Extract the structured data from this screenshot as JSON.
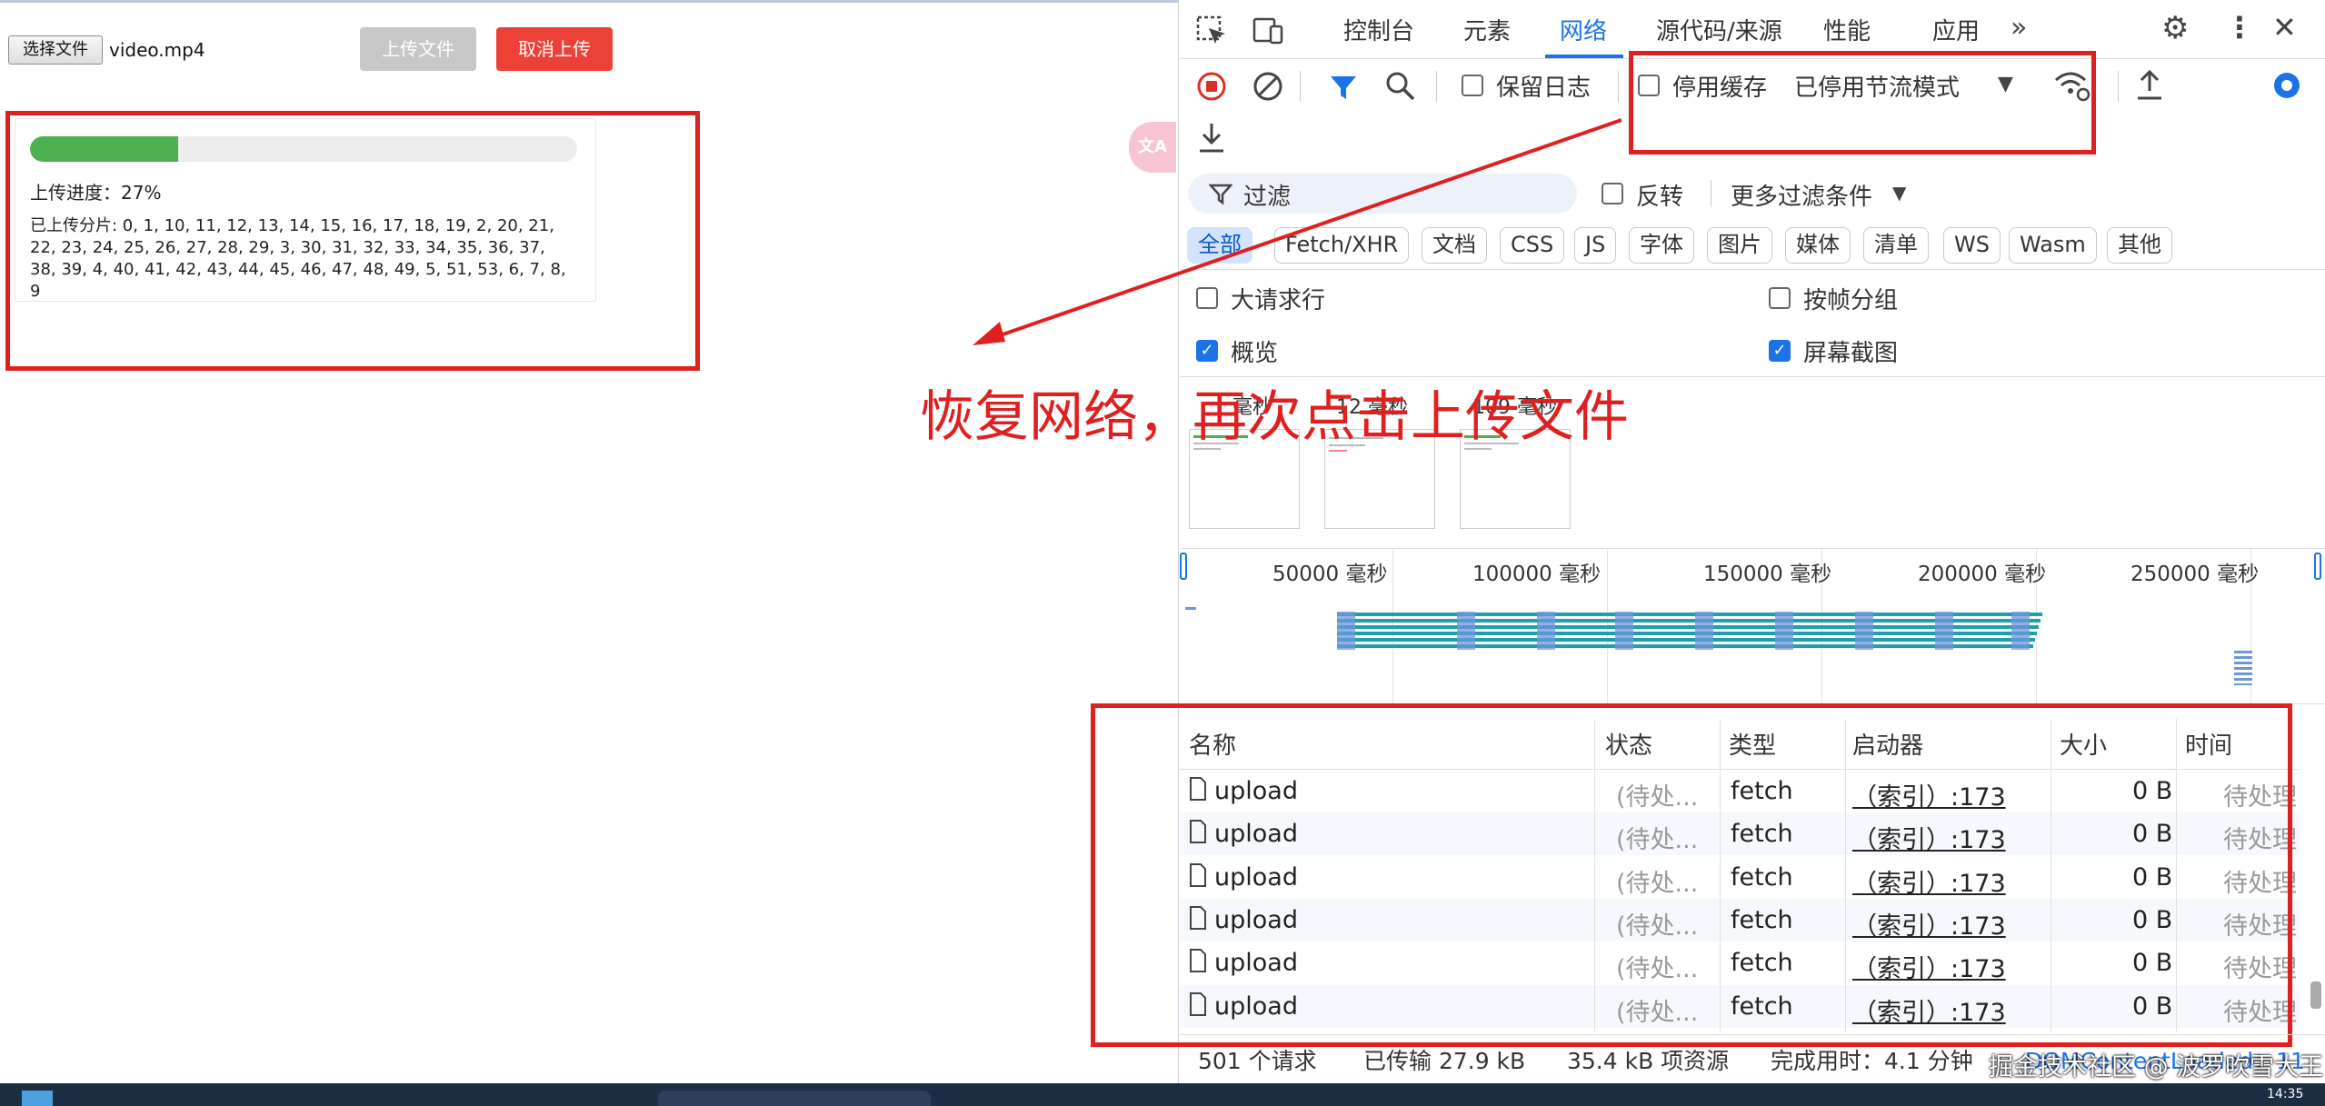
{
  "page": {
    "file_button_label": "选择文件",
    "file_name": "video.mp4",
    "upload_button": "上传文件",
    "cancel_button": "取消上传",
    "progress_percent": 27,
    "progress_text": "上传进度：27%",
    "uploaded_chunks_text": "已上传分片: 0, 1, 10, 11, 12, 13, 14, 15, 16, 17, 18, 19, 2, 20, 21, 22, 23, 24, 25, 26, 27, 28, 29, 3, 30, 31, 32, 33, 34, 35, 36, 37, 38, 39, 4, 40, 41, 42, 43, 44, 45, 46, 47, 48, 49, 5, 51, 53, 6, 7, 8, 9",
    "translate_badge": "文A"
  },
  "annotation": {
    "text": "恢复网络，再次点击上传文件",
    "color": "#e02020"
  },
  "devtools": {
    "tabs": [
      "控制台",
      "元素",
      "网络",
      "源代码/来源",
      "性能",
      "应用"
    ],
    "active_tab": "网络",
    "toolbar": {
      "preserve_log": "保留日志",
      "disable_cache": "停用缓存",
      "throttle": "已停用节流模式"
    },
    "filter_placeholder": "过滤",
    "invert": "反转",
    "more_filters": "更多过滤条件",
    "type_chips": [
      "全部",
      "Fetch/XHR",
      "文档",
      "CSS",
      "JS",
      "字体",
      "图片",
      "媒体",
      "清单",
      "WS",
      "Wasm",
      "其他"
    ],
    "options": {
      "large_rows": "大请求行",
      "group_by_frame": "按帧分组",
      "overview": "概览",
      "screenshots": "屏幕截图"
    },
    "thumb_labels": [
      "毫秒",
      "12 毫秒",
      "109 毫秒"
    ],
    "timeline_labels": [
      "50000 毫秒",
      "100000 毫秒",
      "150000 毫秒",
      "200000 毫秒",
      "250000 毫秒"
    ],
    "table": {
      "headers": [
        "名称",
        "状态",
        "类型",
        "启动器",
        "大小",
        "时间"
      ],
      "rows": [
        {
          "name": "upload",
          "status": "(待处...",
          "type": "fetch",
          "initiator": "（索引）:173",
          "size": "0 B",
          "time": "待处理"
        },
        {
          "name": "upload",
          "status": "(待处...",
          "type": "fetch",
          "initiator": "（索引）:173",
          "size": "0 B",
          "time": "待处理"
        },
        {
          "name": "upload",
          "status": "(待处...",
          "type": "fetch",
          "initiator": "（索引）:173",
          "size": "0 B",
          "time": "待处理"
        },
        {
          "name": "upload",
          "status": "(待处...",
          "type": "fetch",
          "initiator": "（索引）:173",
          "size": "0 B",
          "time": "待处理"
        },
        {
          "name": "upload",
          "status": "(待处...",
          "type": "fetch",
          "initiator": "（索引）:173",
          "size": "0 B",
          "time": "待处理"
        },
        {
          "name": "upload",
          "status": "(待处...",
          "type": "fetch",
          "initiator": "（索引）:173",
          "size": "0 B",
          "time": "待处理"
        }
      ]
    },
    "statusbar": {
      "requests": "501 个请求",
      "transferred": "已传输 27.9 kB",
      "resources": "35.4 kB 项资源",
      "finish": "完成用时：4.1 分钟",
      "dcl": "DOMContentLoaded：11"
    }
  },
  "watermark": "掘金技术社区 @ 波罗吹雪大王",
  "clock": "14:35"
}
